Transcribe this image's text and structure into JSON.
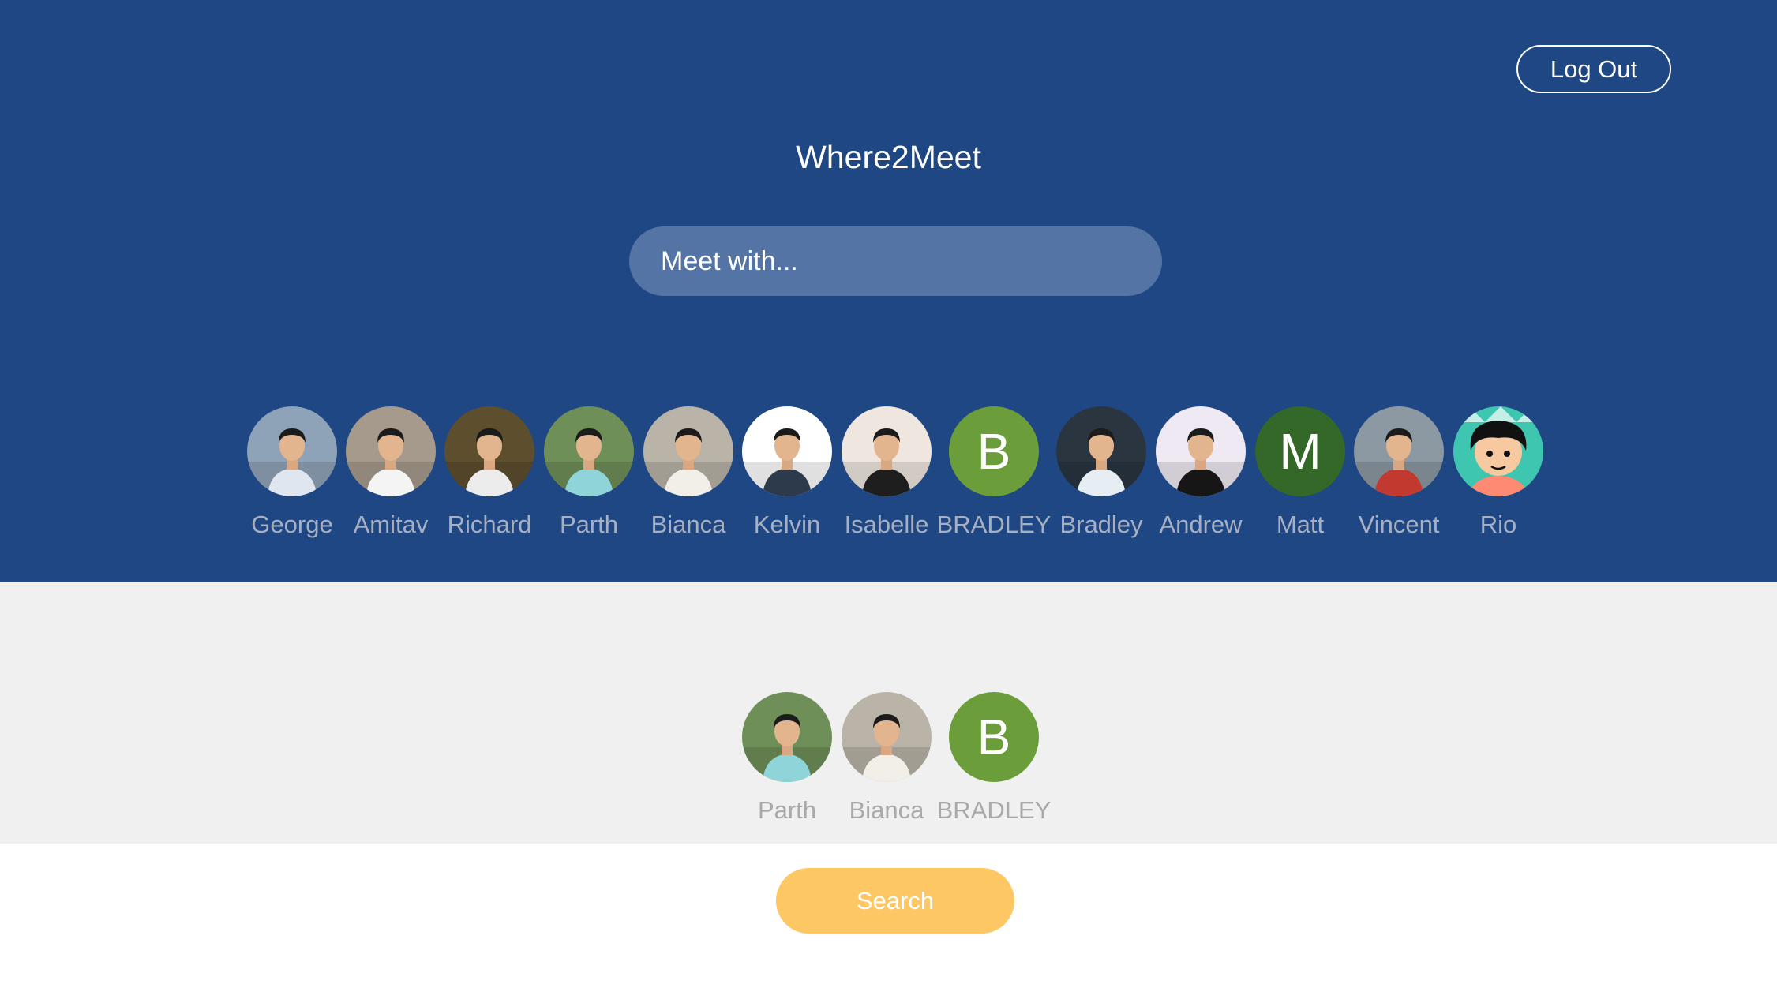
{
  "header": {
    "logout_label": "Log Out",
    "app_title": "Where2Meet",
    "search_placeholder": "Meet with..."
  },
  "friends": [
    {
      "name": "George",
      "avatar": "photo",
      "icon": "person-photo-icon",
      "bg": "#8fa3b8",
      "shirt": "#dfe6f0"
    },
    {
      "name": "Amitav",
      "avatar": "photo",
      "icon": "person-photo-icon",
      "bg": "#a59a8c",
      "shirt": "#f4f4f4"
    },
    {
      "name": "Richard",
      "avatar": "photo",
      "icon": "person-photo-icon",
      "bg": "#5d4e2e",
      "shirt": "#ececec"
    },
    {
      "name": "Parth",
      "avatar": "photo",
      "icon": "person-photo-icon",
      "bg": "#6f8f58",
      "shirt": "#8fd4d8"
    },
    {
      "name": "Bianca",
      "avatar": "photo",
      "icon": "person-photo-icon",
      "bg": "#b9b3a8",
      "shirt": "#f2efe8"
    },
    {
      "name": "Kelvin",
      "avatar": "photo",
      "icon": "person-photo-icon",
      "bg": "#ffffff",
      "shirt": "#2d3a4c"
    },
    {
      "name": "Isabelle",
      "avatar": "photo",
      "icon": "person-photo-icon",
      "bg": "#efe7df",
      "shirt": "#1e1e1e"
    },
    {
      "name": "BRADLEY",
      "avatar": "letter",
      "letter": "B",
      "color": "#6b9e3a"
    },
    {
      "name": "Bradley",
      "avatar": "photo",
      "icon": "person-photo-icon",
      "bg": "#2a3540",
      "shirt": "#e6eef4"
    },
    {
      "name": "Andrew",
      "avatar": "photo",
      "icon": "person-photo-icon",
      "bg": "#efe9f3",
      "shirt": "#161616"
    },
    {
      "name": "Matt",
      "avatar": "letter",
      "letter": "M",
      "color": "#336828"
    },
    {
      "name": "Vincent",
      "avatar": "photo",
      "icon": "person-photo-icon",
      "bg": "#8c98a2",
      "shirt": "#c23a2f"
    },
    {
      "name": "Rio",
      "avatar": "cartoon",
      "icon": "cartoon-avatar-icon",
      "bg": "#3ec6b0",
      "shirt": "#ff8a72"
    }
  ],
  "selected": [
    {
      "name": "Parth",
      "avatar": "photo",
      "icon": "person-photo-icon",
      "bg": "#6f8f58",
      "shirt": "#8fd4d8"
    },
    {
      "name": "Bianca",
      "avatar": "photo",
      "icon": "person-photo-icon",
      "bg": "#b9b3a8",
      "shirt": "#f2efe8"
    },
    {
      "name": "BRADLEY",
      "avatar": "letter",
      "letter": "B",
      "color": "#6b9e3a"
    }
  ],
  "search_label": "Search",
  "colors": {
    "header_bg": "#1e4784",
    "input_bg": "#5474a6",
    "selected_bg": "#f0f0f0",
    "search_button": "#fdc764",
    "name_text": "#a7b0c3"
  }
}
